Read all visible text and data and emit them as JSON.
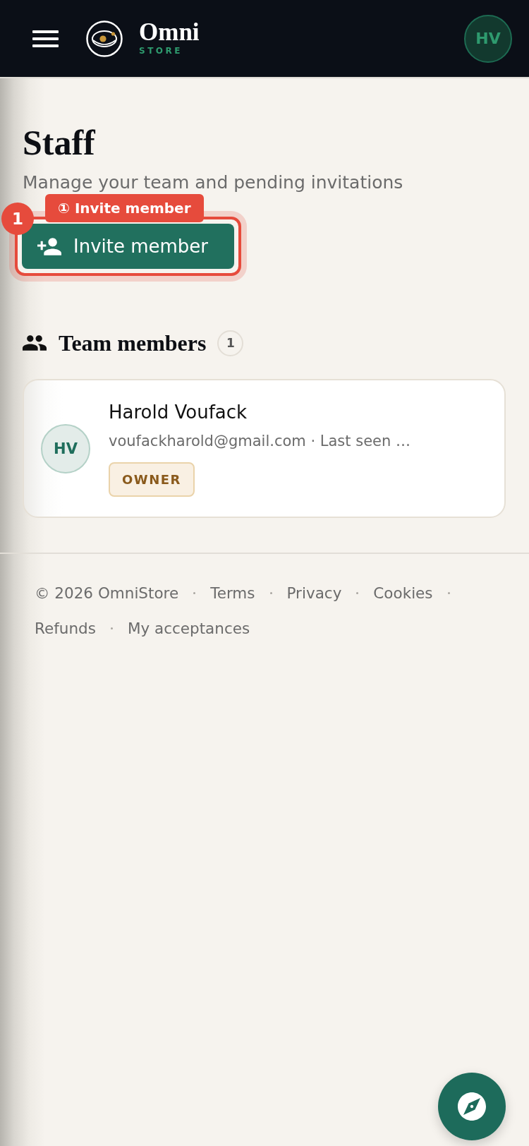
{
  "header": {
    "brand": {
      "name": "Omni",
      "tagline": "STORE"
    },
    "user_initials": "HV"
  },
  "page": {
    "title": "Staff",
    "subtitle": "Manage your team and pending invitations",
    "action": {
      "label": "Invite member",
      "annotation": {
        "number": "1",
        "label": "① Invite member"
      }
    }
  },
  "team": {
    "title": "Team members",
    "count": "1",
    "members": [
      {
        "initials": "HV",
        "name": "Harold Voufack",
        "details": "voufackharold@gmail.com · Last seen …",
        "role": "OWNER"
      }
    ]
  },
  "footer": {
    "copyright": "© 2026 OmniStore",
    "links": [
      "Terms",
      "Privacy",
      "Cookies",
      "Refunds",
      "My acceptances"
    ]
  }
}
